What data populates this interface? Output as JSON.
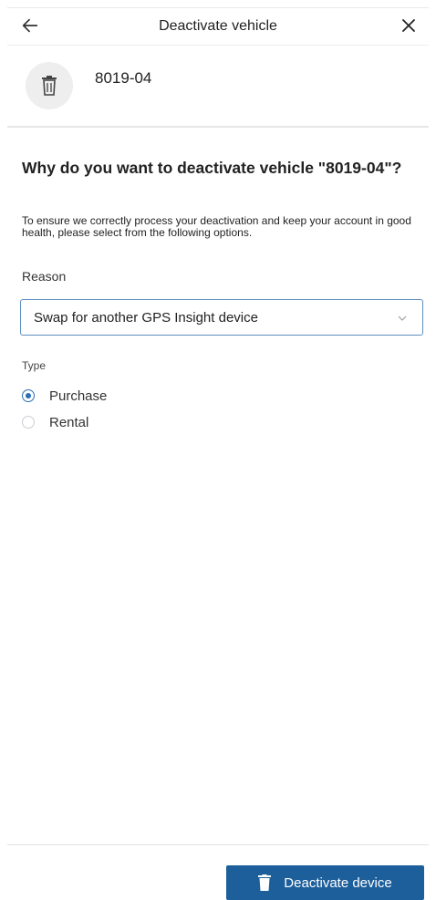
{
  "header": {
    "title": "Deactivate vehicle",
    "back_icon": "arrow-left-icon",
    "close_icon": "close-icon"
  },
  "vehicle": {
    "id": "8019-04",
    "icon": "trash-icon"
  },
  "form": {
    "question": "Why do you want to deactivate vehicle \"8019-04\"?",
    "intro": "To ensure we correctly process your deactivation and keep your account in good health, please select from the following options.",
    "reason_label": "Reason",
    "reason_value": "Swap for another GPS Insight device",
    "type_label": "Type",
    "type_options": [
      {
        "label": "Purchase",
        "selected": true
      },
      {
        "label": "Rental",
        "selected": false
      }
    ]
  },
  "footer": {
    "deactivate_label": "Deactivate device",
    "button_color": "#1d5f9b"
  },
  "colors": {
    "accent": "#2a6fb6",
    "select_border": "#5e8fbf"
  }
}
